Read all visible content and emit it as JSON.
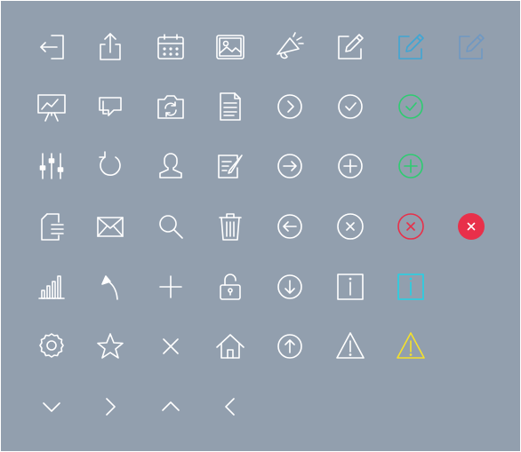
{
  "colors": {
    "background": "#929fae",
    "white": "#ffffff",
    "blue_accent": "#3fa6d4",
    "blue_muted": "#6f98c2",
    "green": "#2ecc71",
    "red": "#e8304a",
    "cyan": "#22d3e6",
    "yellow": "#f5e12a"
  },
  "rows": [
    [
      {
        "icon": "sign-out-icon",
        "color": "white"
      },
      {
        "icon": "share-upload-icon",
        "color": "white"
      },
      {
        "icon": "calendar-icon",
        "color": "white"
      },
      {
        "icon": "image-icon",
        "color": "white"
      },
      {
        "icon": "megaphone-icon",
        "color": "white"
      },
      {
        "icon": "edit-square-icon",
        "color": "white"
      },
      {
        "icon": "edit-square-icon",
        "color": "blue_accent"
      },
      {
        "icon": "edit-square-icon",
        "color": "blue_muted"
      }
    ],
    [
      {
        "icon": "presentation-chart-icon",
        "color": "white"
      },
      {
        "icon": "chat-bubbles-icon",
        "color": "white"
      },
      {
        "icon": "camera-switch-icon",
        "color": "white"
      },
      {
        "icon": "document-icon",
        "color": "white"
      },
      {
        "icon": "chevron-right-circle-icon",
        "color": "white"
      },
      {
        "icon": "check-circle-icon",
        "color": "white"
      },
      {
        "icon": "check-circle-icon",
        "color": "green"
      }
    ],
    [
      {
        "icon": "sliders-icon",
        "color": "white"
      },
      {
        "icon": "refresh-icon",
        "color": "white"
      },
      {
        "icon": "user-icon",
        "color": "white"
      },
      {
        "icon": "compose-icon",
        "color": "white"
      },
      {
        "icon": "arrow-right-circle-icon",
        "color": "white"
      },
      {
        "icon": "plus-circle-icon",
        "color": "white"
      },
      {
        "icon": "plus-circle-icon",
        "color": "green"
      }
    ],
    [
      {
        "icon": "file-list-icon",
        "color": "white"
      },
      {
        "icon": "mail-icon",
        "color": "white"
      },
      {
        "icon": "search-icon",
        "color": "white"
      },
      {
        "icon": "trash-icon",
        "color": "white"
      },
      {
        "icon": "arrow-left-circle-icon",
        "color": "white"
      },
      {
        "icon": "close-circle-icon",
        "color": "white"
      },
      {
        "icon": "close-circle-icon",
        "color": "red"
      },
      {
        "icon": "close-circle-filled-icon",
        "color": "red"
      }
    ],
    [
      {
        "icon": "bar-chart-icon",
        "color": "white"
      },
      {
        "icon": "reply-arrow-icon",
        "color": "white"
      },
      {
        "icon": "plus-icon",
        "color": "white"
      },
      {
        "icon": "unlock-icon",
        "color": "white"
      },
      {
        "icon": "arrow-down-circle-icon",
        "color": "white"
      },
      {
        "icon": "info-box-icon",
        "color": "white"
      },
      {
        "icon": "info-box-icon",
        "color": "cyan"
      }
    ],
    [
      {
        "icon": "gear-icon",
        "color": "white"
      },
      {
        "icon": "star-icon",
        "color": "white"
      },
      {
        "icon": "close-icon",
        "color": "white"
      },
      {
        "icon": "home-icon",
        "color": "white"
      },
      {
        "icon": "arrow-up-circle-icon",
        "color": "white"
      },
      {
        "icon": "warning-icon",
        "color": "white"
      },
      {
        "icon": "warning-icon",
        "color": "yellow"
      }
    ],
    [
      {
        "icon": "chevron-down-icon",
        "color": "white"
      },
      {
        "icon": "chevron-right-icon",
        "color": "white"
      },
      {
        "icon": "chevron-up-icon",
        "color": "white"
      },
      {
        "icon": "chevron-left-icon",
        "color": "white"
      }
    ]
  ]
}
